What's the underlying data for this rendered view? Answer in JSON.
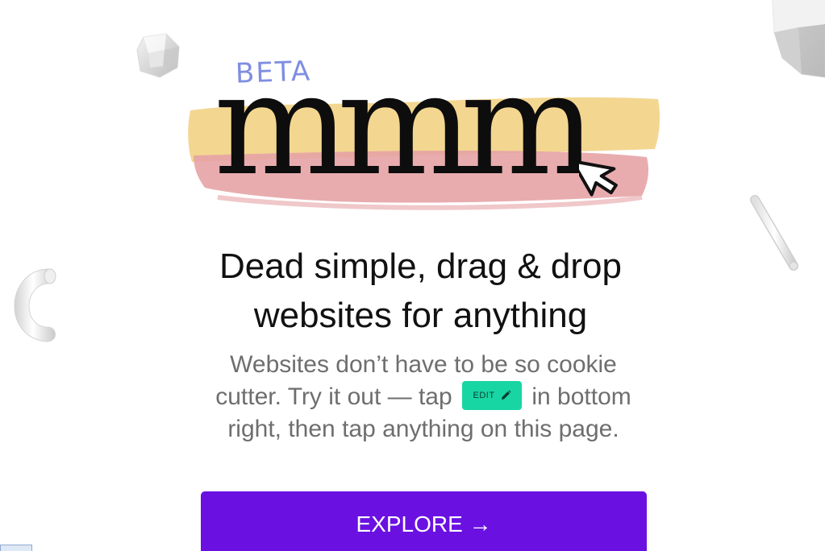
{
  "hero": {
    "beta_label": "BETA",
    "logo_word": "mmm"
  },
  "headline": {
    "line1": "Dead simple, drag & drop",
    "line2": "websites for anything"
  },
  "subtext": {
    "part1": "Websites don’t have to be so cookie",
    "part2": "cutter. Try it out — tap",
    "edit_chip_label": "EDIT",
    "part3": "in bottom",
    "part4": "right, then tap anything on this page."
  },
  "cta": {
    "explore_label": "EXPLORE →"
  },
  "colors": {
    "accent_purple": "#6a11e2",
    "edit_green": "#17d6a4",
    "beta_blue": "#7f8ee0",
    "brush_yellow": "#f2d48a",
    "brush_pink": "#e6a3a6"
  },
  "icons": {
    "edit_chip_icon": "pencil-icon",
    "logo_cursor": "mouse-pointer-icon"
  }
}
